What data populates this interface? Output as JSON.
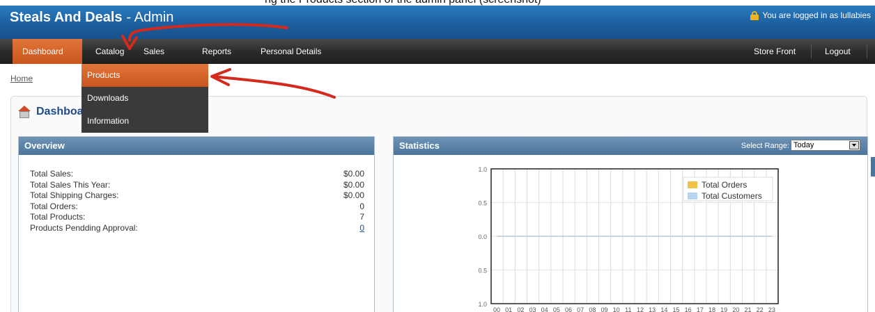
{
  "caption": "ng the Products section of the admin panel (screenshot)",
  "header": {
    "brand": "Steals And Deals",
    "brand_suffix": "Admin",
    "login_text": "You are logged in as lullabies"
  },
  "nav": {
    "items": [
      {
        "label": "Dashboard"
      },
      {
        "label": "Catalog"
      },
      {
        "label": "Sales"
      },
      {
        "label": "Reports"
      },
      {
        "label": "Personal Details"
      }
    ],
    "right_items": [
      {
        "label": "Store Front"
      },
      {
        "label": "Logout"
      }
    ]
  },
  "dropdown": {
    "items": [
      {
        "label": "Products"
      },
      {
        "label": "Downloads"
      },
      {
        "label": "Information"
      }
    ]
  },
  "breadcrumb": "Home",
  "page_title": "Dashboard",
  "overview": {
    "title": "Overview",
    "rows": [
      {
        "label": "Total Sales:",
        "value": "$0.00"
      },
      {
        "label": "Total Sales This Year:",
        "value": "$0.00"
      },
      {
        "label": "Total Shipping Charges:",
        "value": "$0.00"
      },
      {
        "label": "Total Orders:",
        "value": "0"
      },
      {
        "label": "Total Products:",
        "value": "7"
      },
      {
        "label": "Products Pendding Approval:",
        "value": "0"
      }
    ]
  },
  "statistics": {
    "title": "Statistics",
    "range_label": "Select Range:",
    "range_value": "Today"
  },
  "colors": {
    "accent_orange": "#d2622a",
    "header_blue": "#1b5d9c",
    "orders_color": "#f0c24a",
    "customers_color": "#b7d4f0",
    "annotation_red": "#d42a1e"
  },
  "chart_data": {
    "type": "line",
    "x": [
      "00",
      "01",
      "02",
      "03",
      "04",
      "05",
      "06",
      "07",
      "08",
      "09",
      "10",
      "11",
      "12",
      "13",
      "14",
      "15",
      "16",
      "17",
      "18",
      "19",
      "20",
      "21",
      "22",
      "23"
    ],
    "series": [
      {
        "name": "Total Orders",
        "values": [
          0,
          0,
          0,
          0,
          0,
          0,
          0,
          0,
          0,
          0,
          0,
          0,
          0,
          0,
          0,
          0,
          0,
          0,
          0,
          0,
          0,
          0,
          0,
          0
        ]
      },
      {
        "name": "Total Customers",
        "values": [
          0,
          0,
          0,
          0,
          0,
          0,
          0,
          0,
          0,
          0,
          0,
          0,
          0,
          0,
          0,
          0,
          0,
          0,
          0,
          0,
          0,
          0,
          0,
          0
        ]
      }
    ],
    "y_ticks": [
      "1.0",
      "0.5",
      "0.0",
      "0.5",
      "1.0"
    ],
    "ylim": [
      -1,
      1
    ],
    "grid": true,
    "legend": "top-right"
  }
}
